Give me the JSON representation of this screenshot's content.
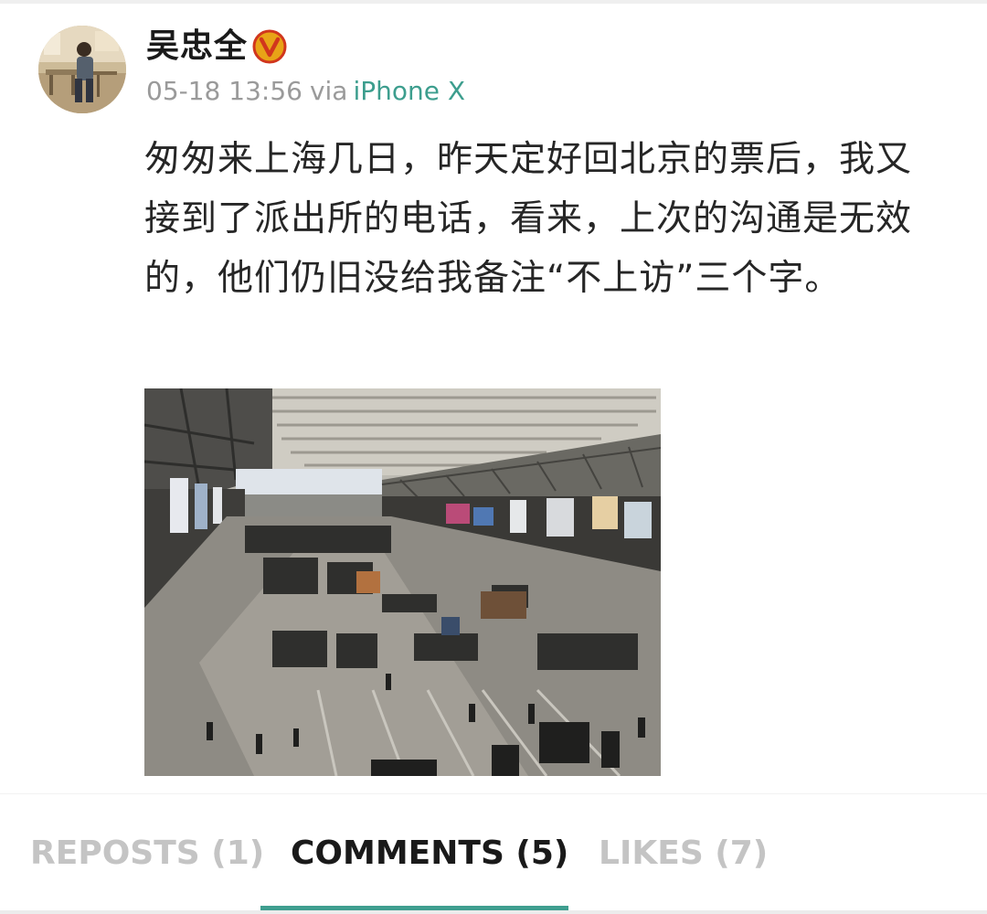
{
  "post": {
    "author": "吴忠全",
    "date": "05-18 13:56",
    "via_label": "via",
    "device": "iPhone X",
    "text": "匆匆来上海几日，昨天定好回北京的票后，我又接到了派出所的电话，看来，上次的沟通是无效的，他们仍旧没给我备注“不上访”三个字。",
    "badge_icon": "verified-v-icon",
    "badge_color": "#e8a317",
    "badge_ring_color": "#d1361d"
  },
  "tabs": [
    {
      "label": "REPOSTS (1)",
      "active": false
    },
    {
      "label": "COMMENTS (5)",
      "active": true
    },
    {
      "label": "LIKES (7)",
      "active": false
    }
  ],
  "colors": {
    "accent": "#3f9e8f",
    "device_link": "#3d9e8e",
    "inactive_tab": "#c4c4c4",
    "active_tab": "#1a1a1a"
  }
}
